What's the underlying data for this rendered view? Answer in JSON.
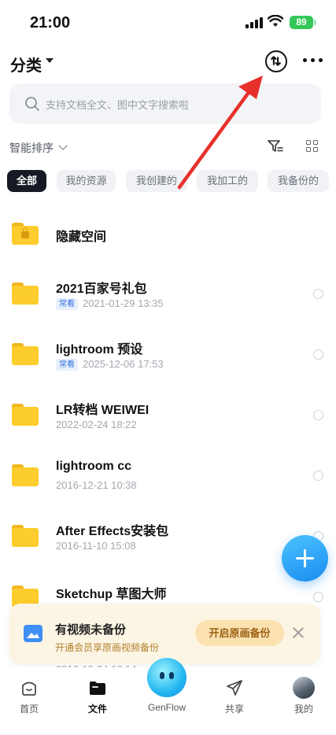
{
  "status_bar": {
    "time": "21:00",
    "battery": "89"
  },
  "header": {
    "title": "分类",
    "transfer_icon": "transfer-icon",
    "more_icon": "more-dots-icon"
  },
  "search": {
    "placeholder": "支持文档全文、图中文字搜索啦"
  },
  "sort": {
    "label": "智能排序"
  },
  "chips": [
    "全部",
    "我的资源",
    "我创建的",
    "我加工的",
    "我备份的"
  ],
  "files": [
    {
      "name": "隐藏空间",
      "tag": "",
      "date": "",
      "locked": true
    },
    {
      "name": "2021百家号礼包",
      "tag": "常看",
      "date": "2021-01-29 13:35"
    },
    {
      "name": "lightroom 预设",
      "tag": "常看",
      "date": "2025-12-06 17:53"
    },
    {
      "name": "LR转档   WEIWEI",
      "tag": "",
      "date": "2022-02-24 18:22"
    },
    {
      "name": "lightroom cc",
      "tag": "",
      "date": "2016-12-21 10:38"
    },
    {
      "name": "After Effects安装包",
      "tag": "",
      "date": "2016-11-10 15:08"
    },
    {
      "name": "Sketchup 草图大师",
      "tag": "",
      "date": "2016-10-24 16:14"
    }
  ],
  "banner": {
    "title": "有视频未备份",
    "subtitle": "开通会员享原画视频备份",
    "button": "开启原画备份"
  },
  "tabbar": {
    "home": "首页",
    "files": "文件",
    "genflow": "GenFlow",
    "share": "共享",
    "mine": "我的"
  },
  "colors": {
    "accent": "#1a8cf0",
    "folder": "#fccd2c",
    "annotation_arrow": "#e8302a"
  }
}
